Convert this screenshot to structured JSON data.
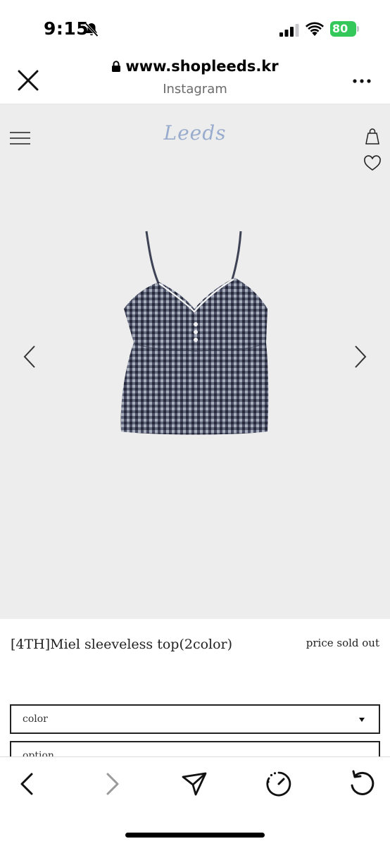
{
  "status_bar": {
    "time": "9:15",
    "battery": "80",
    "icons": [
      "bell-off-icon",
      "signal-icon",
      "wifi-icon",
      "battery-icon"
    ]
  },
  "browser": {
    "url": "www.shopleeds.kr",
    "source": "Instagram",
    "icons": [
      "close-icon",
      "lock-icon",
      "more-icon"
    ]
  },
  "site": {
    "logo": "Leeds",
    "icons": [
      "menu-icon",
      "shopping-bag-icon",
      "heart-icon",
      "chevron-left-icon",
      "chevron-right-icon"
    ]
  },
  "product": {
    "name": "[4TH]Miel sleeveless top(2color)",
    "price_status": "price sold out",
    "image": "gingham-camisole-top"
  },
  "options": {
    "color_label": "color",
    "option_label": "option"
  },
  "toolbar": {
    "icons": [
      "back-icon",
      "forward-icon",
      "share-icon",
      "speed-icon",
      "reload-icon"
    ]
  },
  "colors": {
    "battery": "#34c759",
    "site_background": "#ededed",
    "logo": "#9aaccd"
  }
}
